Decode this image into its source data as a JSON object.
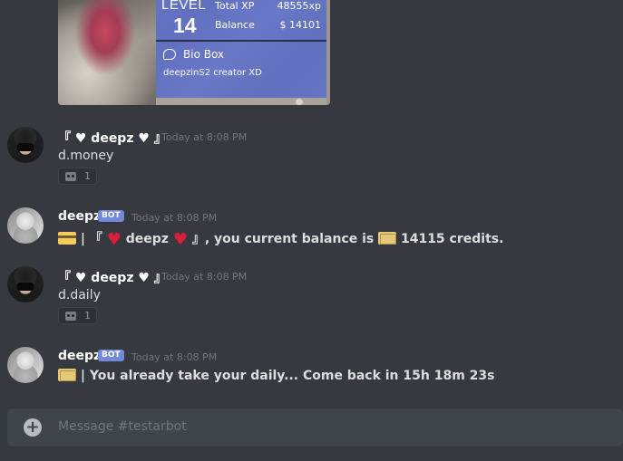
{
  "profile_card": {
    "level_label": "LEVEL",
    "level_value": "14",
    "total_xp_label": "Total XP",
    "total_xp_value": "48555xp",
    "balance_label": "Balance",
    "balance_value": "$ 14101",
    "bio_title": "Bio Box",
    "bio_text": "deepzinS2 creator XD"
  },
  "messages": [
    {
      "username": "『 ♥ deepz ♥ 』",
      "timestamp": "Today at 8:08 PM",
      "content": "d.money",
      "reaction_count": "1"
    },
    {
      "username": "deepz",
      "badge": "BOT",
      "timestamp": "Today at 8:08 PM",
      "content_prefix": "| 『",
      "content_name": "deepz",
      "content_middle": "』, you current balance is",
      "content_amount": "14115 credits."
    },
    {
      "username": "『 ♥ deepz ♥ 』",
      "timestamp": "Today at 8:08 PM",
      "content": "d.daily",
      "reaction_count": "1"
    },
    {
      "username": "deepz",
      "badge": "BOT",
      "timestamp": "Today at 8:08 PM",
      "content": "| You already take your daily... Come back in 15h 18m 23s"
    }
  ],
  "composer": {
    "placeholder": "Message #testarbot",
    "plus_label": "+"
  }
}
